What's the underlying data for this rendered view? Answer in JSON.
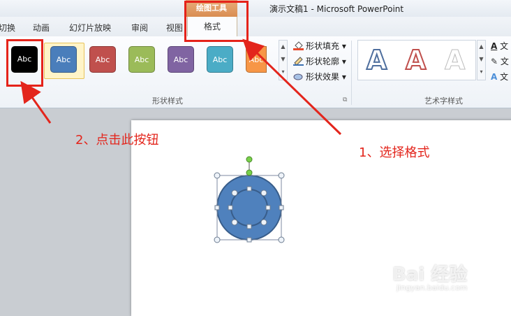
{
  "window": {
    "title": "演示文稿1 - Microsoft PowerPoint"
  },
  "tabs": [
    "切换",
    "动画",
    "幻灯片放映",
    "审阅",
    "视图"
  ],
  "context": {
    "group": "绘图工具",
    "tab": "格式"
  },
  "shape_styles": {
    "label": "形状样式",
    "items": [
      {
        "text": "Abc",
        "color": "#000000"
      },
      {
        "text": "Abc",
        "color": "#4a7ebb"
      },
      {
        "text": "Abc",
        "color": "#c0504d"
      },
      {
        "text": "Abc",
        "color": "#9bbb59"
      },
      {
        "text": "Abc",
        "color": "#8064a2"
      },
      {
        "text": "Abc",
        "color": "#4bacc6"
      },
      {
        "text": "Abc",
        "color": "#f79646"
      }
    ],
    "fill": "形状填充",
    "outline": "形状轮廓",
    "effects": "形状效果"
  },
  "wordart": {
    "label": "艺术字样式",
    "letters": [
      "A",
      "A",
      "A"
    ],
    "cmd_prefix": "文"
  },
  "annotations": {
    "step1": "1、选择格式",
    "step2": "2、点击此按钮"
  },
  "watermark": {
    "brand": "Bai 经验",
    "url": "jingyan.baidu.com"
  },
  "colors": {
    "annotation": "#e3251c",
    "shape_fill": "#4f81bd",
    "shape_stroke": "#385d8a"
  }
}
